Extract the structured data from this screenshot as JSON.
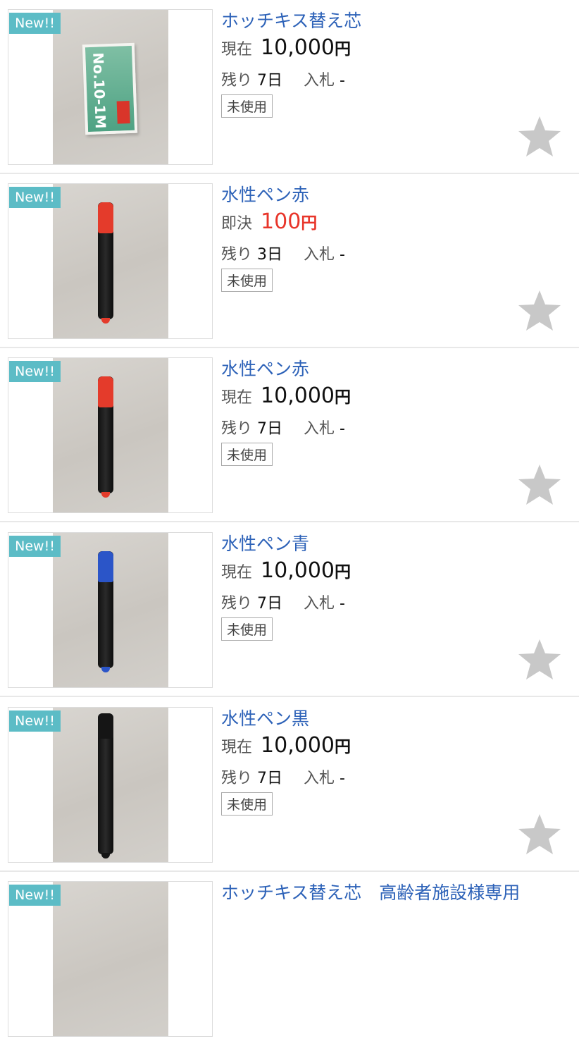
{
  "items": [
    {
      "badge": "New!!",
      "title": "ホッチキス替え芯",
      "price_label": "現在",
      "price_number": "10,000",
      "price_unit": "円",
      "price_color": "#111111",
      "remaining_label": "残り",
      "remaining_value": "7日",
      "bids_label": "入札",
      "bids_value": "-",
      "condition": "未使用",
      "image": "staple-box",
      "box_text": "No.10-1M"
    },
    {
      "badge": "New!!",
      "title": "水性ペン赤",
      "price_label": "即決",
      "price_number": "100",
      "price_unit": "円",
      "price_color": "#e8352a",
      "remaining_label": "残り",
      "remaining_value": "3日",
      "bids_label": "入札",
      "bids_value": "-",
      "condition": "未使用",
      "image": "pen",
      "pen_cap_color": "#e43b2b"
    },
    {
      "badge": "New!!",
      "title": "水性ペン赤",
      "price_label": "現在",
      "price_number": "10,000",
      "price_unit": "円",
      "price_color": "#111111",
      "remaining_label": "残り",
      "remaining_value": "7日",
      "bids_label": "入札",
      "bids_value": "-",
      "condition": "未使用",
      "image": "pen",
      "pen_cap_color": "#e43b2b"
    },
    {
      "badge": "New!!",
      "title": "水性ペン青",
      "price_label": "現在",
      "price_number": "10,000",
      "price_unit": "円",
      "price_color": "#111111",
      "remaining_label": "残り",
      "remaining_value": "7日",
      "bids_label": "入札",
      "bids_value": "-",
      "condition": "未使用",
      "image": "pen",
      "pen_cap_color": "#2b55c8"
    },
    {
      "badge": "New!!",
      "title": "水性ペン黒",
      "price_label": "現在",
      "price_number": "10,000",
      "price_unit": "円",
      "price_color": "#111111",
      "remaining_label": "残り",
      "remaining_value": "7日",
      "bids_label": "入札",
      "bids_value": "-",
      "condition": "未使用",
      "image": "pen",
      "pen_cap_color": "#151515"
    },
    {
      "badge": "New!!",
      "title": "ホッチキス替え芯　高齢者施設様専用"
    }
  ],
  "colors": {
    "badge": "#5cbcc6",
    "title_link": "#2d62b8",
    "star": "#c8c8c8",
    "divider": "#e8e8e8"
  },
  "icons": {
    "favorite": "star-icon"
  }
}
